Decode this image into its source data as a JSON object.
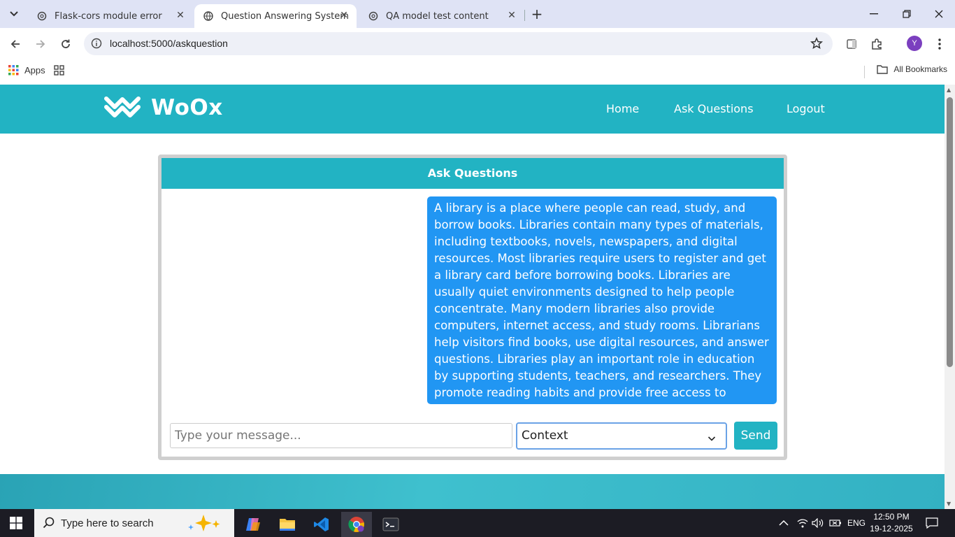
{
  "browser": {
    "tabs": [
      {
        "title": "Flask-cors module error",
        "active": false
      },
      {
        "title": "Question Answering System",
        "active": true
      },
      {
        "title": "QA model test content",
        "active": false
      }
    ],
    "url": "localhost:5000/askquestion",
    "profile_initial": "Y",
    "bookmarks": {
      "apps_label": "Apps",
      "all_bookmarks_label": "All Bookmarks"
    }
  },
  "site": {
    "brand": "WoOx",
    "nav": [
      "Home",
      "Ask Questions",
      "Logout"
    ]
  },
  "chat": {
    "title": "Ask Questions",
    "message": "A library is a place where people can read, study, and borrow books. Libraries contain many types of materials, including textbooks, novels, newspapers, and digital resources. Most libraries require users to register and get a library card before borrowing books. Libraries are usually quiet environments designed to help people concentrate. Many modern libraries also provide computers, internet access, and study rooms. Librarians help visitors find books, use digital resources, and answer questions. Libraries play an important role in education by supporting students, teachers, and researchers. They promote reading habits and provide free access to information for the community.",
    "input_placeholder": "Type your message...",
    "mode_selected": "Context",
    "send_label": "Send"
  },
  "taskbar": {
    "search_placeholder": "Type here to search",
    "language": "ENG",
    "time": "12:50 PM",
    "date": "19-12-2025"
  },
  "colors": {
    "brand": "#22b3c3",
    "bubble": "#2196f3"
  }
}
